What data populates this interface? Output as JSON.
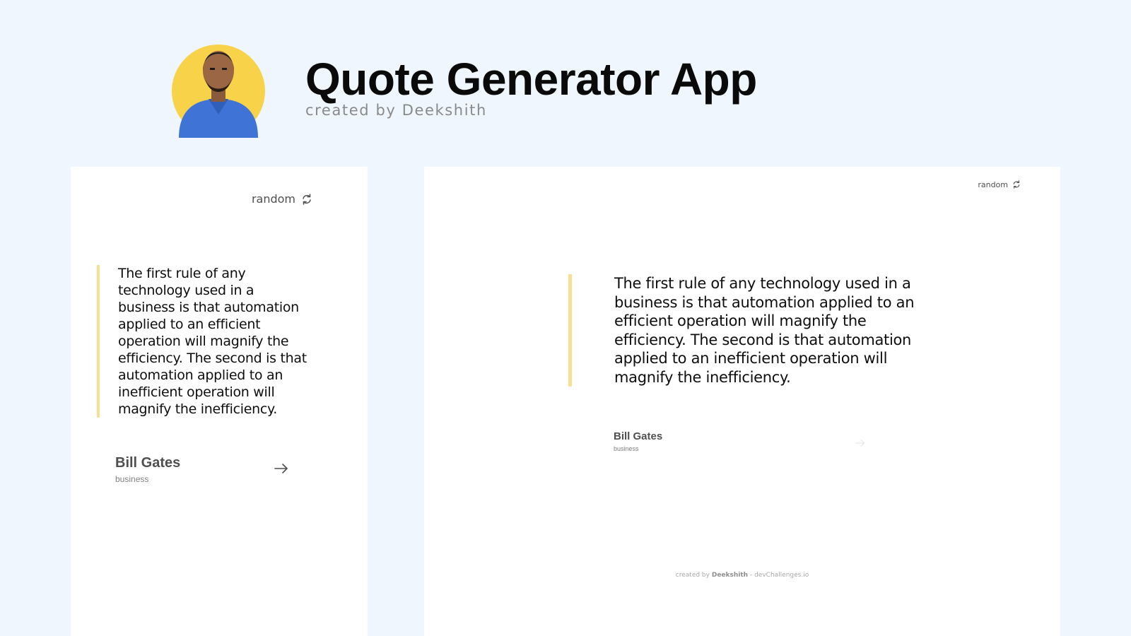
{
  "header": {
    "title": "Quote Generator App",
    "subtitle": "created by Deekshith",
    "avatar_circle_color": "#f8d34a"
  },
  "accent_color": "#f7df94",
  "random": {
    "label": "random",
    "icon": "refresh-icon"
  },
  "quote": {
    "text": "The first rule of any technology used in a business is that automation applied to an efficient operation will magnify the efficiency. The second is that automation applied to an inefficient operation will magnify the inefficiency.",
    "author": "Bill Gates",
    "genre": "business",
    "arrow_icon": "arrow-right-icon"
  },
  "footer": {
    "prefix": "created by",
    "author": "Deekshith",
    "separator": "-",
    "site": "devChallenges.io"
  }
}
